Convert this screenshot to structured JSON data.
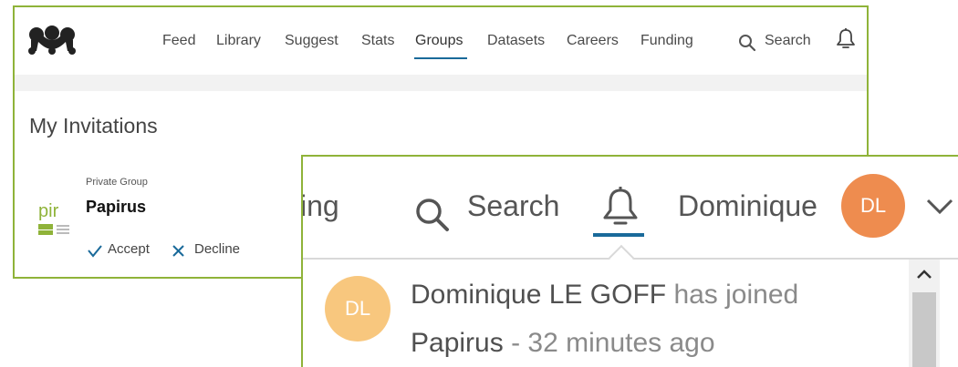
{
  "nav": {
    "logo_icon": "mendeley-logo-icon",
    "items": [
      {
        "label": "Feed"
      },
      {
        "label": "Library"
      },
      {
        "label": "Suggest"
      },
      {
        "label": "Stats"
      },
      {
        "label": "Groups",
        "active": true
      },
      {
        "label": "Datasets"
      },
      {
        "label": "Careers"
      },
      {
        "label": "Funding"
      }
    ],
    "search_label": "Search",
    "bell_icon": "bell-icon"
  },
  "page": {
    "title": "My Invitations"
  },
  "invitation": {
    "kind": "Private Group",
    "group_name": "Papirus",
    "accept_label": "Accept",
    "decline_label": "Decline"
  },
  "zoom_header": {
    "partial_nav_text": "ing",
    "search_label": "Search",
    "user_name": "Dominique",
    "avatar_initials": "DL",
    "avatar_color": "#ee8c4f"
  },
  "notification": {
    "avatar_initials": "DL",
    "avatar_color": "#f8c77e",
    "actor": "Dominique LE GOFF",
    "action": "has joined",
    "group": "Papirus",
    "separator": "-",
    "time": "32 minutes ago"
  },
  "colors": {
    "frame_border": "#8fb339",
    "active_underline": "#1a6a9a",
    "action_icon": "#1a6a9a"
  }
}
